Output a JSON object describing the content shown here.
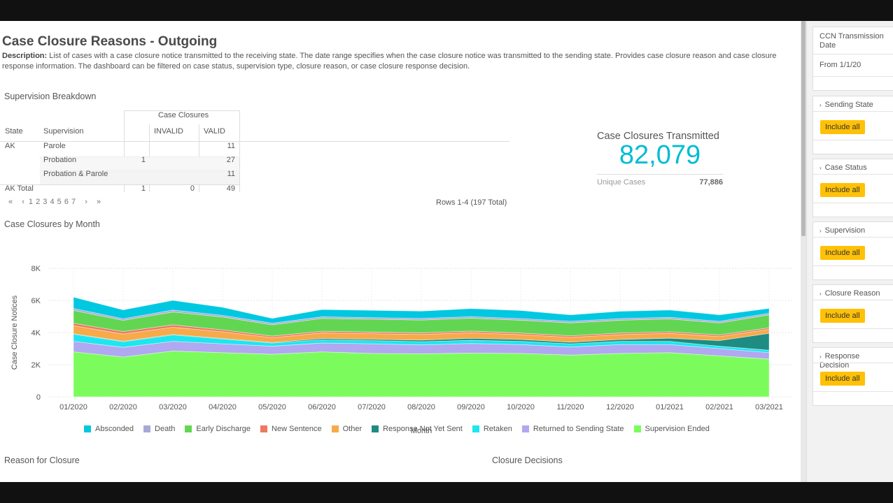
{
  "page": {
    "title": "Case Closure Reasons - Outgoing",
    "description_label": "Description:",
    "description_text": "List of cases with a case closure notice transmitted to the receiving state. The date range specifies when the case closure notice was transmitted to the sending state. Provides case closure reason and case closure response information. The dashboard can be filtered on case status, supervision type, closure reason, or case closure response decision."
  },
  "supervision_breakdown": {
    "title": "Supervision Breakdown",
    "group_header": "Case Closures",
    "columns": [
      "State",
      "Supervision",
      "",
      "INVALID",
      "VALID"
    ],
    "rows": [
      {
        "state": "AK",
        "supervision": "Parole",
        "blank": "",
        "invalid": "",
        "valid": "11"
      },
      {
        "state": "",
        "supervision": "Probation",
        "blank": "1",
        "invalid": "",
        "valid": "27"
      },
      {
        "state": "",
        "supervision": "Probation & Parole",
        "blank": "",
        "invalid": "",
        "valid": "11"
      }
    ],
    "total_row": {
      "state": "AK Total",
      "blank": "1",
      "invalid": "0",
      "valid": "49"
    },
    "pager": {
      "first": "«",
      "prev": "‹",
      "pages": [
        "1",
        "2",
        "3",
        "4",
        "5",
        "6",
        "7"
      ],
      "next": "›",
      "last": "»"
    },
    "rows_total": "Rows 1-4 (197 Total)"
  },
  "kpi": {
    "label": "Case Closures Transmitted",
    "value": "82,079",
    "sub_label": "Unique Cases",
    "sub_value": "77,886"
  },
  "chart_section_title": "Case Closures by Month",
  "chart_data": {
    "type": "area",
    "stacked": true,
    "xlabel": "Month",
    "ylabel": "Case Closure Notices",
    "ylim": [
      0,
      8000
    ],
    "yticks": [
      "0",
      "2K",
      "4K",
      "6K",
      "8K"
    ],
    "categories": [
      "01/2020",
      "02/2020",
      "03/2020",
      "04/2020",
      "05/2020",
      "06/2020",
      "07/2020",
      "08/2020",
      "09/2020",
      "10/2020",
      "11/2020",
      "12/2020",
      "01/2021",
      "02/2021",
      "03/2021"
    ],
    "series": [
      {
        "name": "Supervision Ended",
        "color": "#7cfc5c",
        "values": [
          2800,
          2480,
          2850,
          2750,
          2650,
          2800,
          2700,
          2680,
          2720,
          2700,
          2600,
          2700,
          2750,
          2550,
          2350
        ]
      },
      {
        "name": "Returned to Sending State",
        "color": "#b0a8f0",
        "values": [
          650,
          600,
          600,
          550,
          500,
          550,
          600,
          550,
          600,
          550,
          500,
          550,
          500,
          450,
          400
        ]
      },
      {
        "name": "Retaken",
        "color": "#1ee6f0",
        "values": [
          450,
          350,
          400,
          300,
          200,
          200,
          200,
          200,
          200,
          200,
          200,
          200,
          200,
          150,
          150
        ]
      },
      {
        "name": "Response Not Yet Sent",
        "color": "#1e8c82",
        "values": [
          30,
          30,
          30,
          30,
          30,
          80,
          80,
          100,
          120,
          120,
          100,
          120,
          200,
          350,
          1050
        ]
      },
      {
        "name": "Other",
        "color": "#f7aa4a",
        "values": [
          500,
          450,
          450,
          420,
          300,
          350,
          350,
          350,
          350,
          300,
          300,
          300,
          300,
          250,
          250
        ]
      },
      {
        "name": "New Sentence",
        "color": "#f07860",
        "values": [
          150,
          150,
          150,
          120,
          100,
          100,
          100,
          100,
          100,
          100,
          100,
          100,
          100,
          100,
          100
        ]
      },
      {
        "name": "Early Discharge",
        "color": "#62d652",
        "values": [
          800,
          700,
          800,
          800,
          700,
          800,
          800,
          800,
          800,
          800,
          800,
          800,
          800,
          750,
          800
        ]
      },
      {
        "name": "Death",
        "color": "#a8a8d8",
        "values": [
          120,
          100,
          120,
          100,
          100,
          100,
          100,
          100,
          100,
          100,
          100,
          100,
          100,
          100,
          100
        ]
      },
      {
        "name": "Absconded",
        "color": "#00c8e0",
        "values": [
          700,
          550,
          600,
          500,
          300,
          450,
          450,
          450,
          500,
          500,
          400,
          450,
          450,
          400,
          300
        ]
      }
    ],
    "legend_order": [
      "Absconded",
      "Death",
      "Early Discharge",
      "New Sentence",
      "Other",
      "Response Not Yet Sent",
      "Retaken",
      "Returned to Sending State",
      "Supervision Ended"
    ],
    "legend_placement": "bottom",
    "grid": true
  },
  "bottom_sections": {
    "left": "Reason for Closure",
    "right": "Closure Decisions"
  },
  "sidebar": {
    "date_filter": {
      "label": "CCN Transmission Date",
      "value": "From 1/1/20"
    },
    "filters": [
      {
        "label": "Sending State",
        "button": "Include all"
      },
      {
        "label": "Case Status",
        "button": "Include all"
      },
      {
        "label": "Supervision",
        "button": "Include all"
      },
      {
        "label": "Closure Reason",
        "button": "Include all"
      },
      {
        "label": "Response Decision",
        "button": "Include all"
      }
    ],
    "chevron": "›"
  }
}
